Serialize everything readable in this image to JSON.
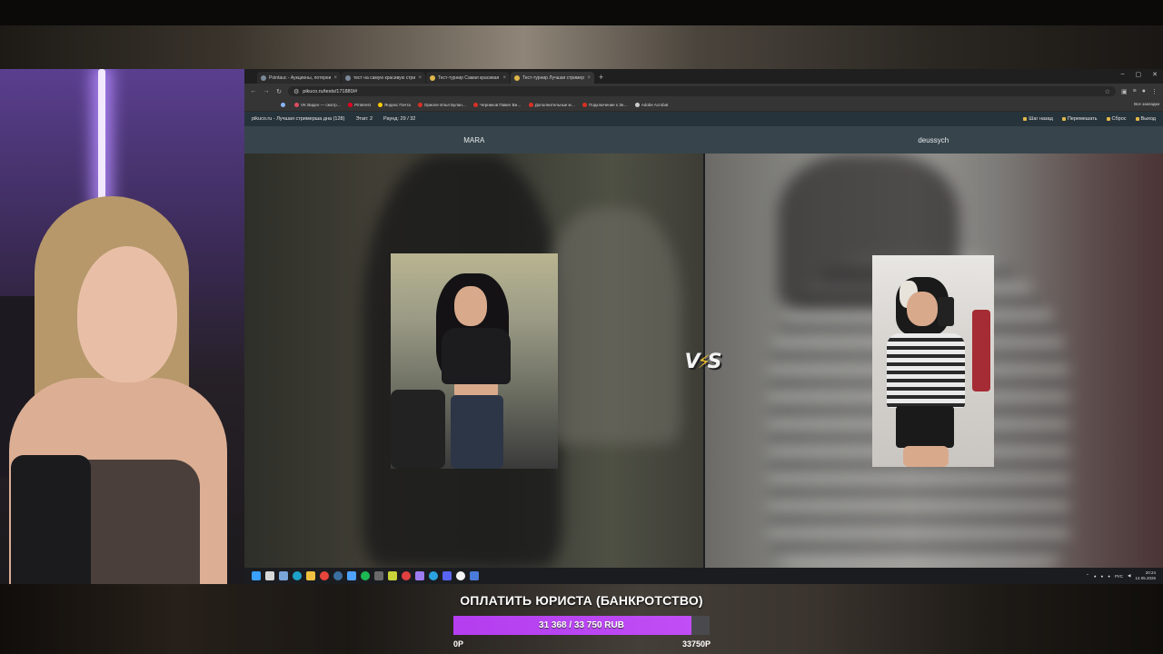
{
  "browser": {
    "tabs": [
      {
        "title": "Pointauc - Аукционы, лотереи",
        "active": false
      },
      {
        "title": "тест на самую красивую стри…",
        "active": false
      },
      {
        "title": "Тест-турнир Самая красивая…",
        "active": false
      },
      {
        "title": "Тест-турнир Лучшая стример…",
        "active": true
      }
    ],
    "url": "pikuco.ru/tests/171880/#",
    "bookmarks": [
      {
        "label": "",
        "color": "#8ab4f8"
      },
      {
        "label": "VK Видео — смотр…",
        "color": "#e04c5f"
      },
      {
        "label": "Pinterest",
        "color": "#e60023"
      },
      {
        "label": "Яндекс Почта",
        "color": "#ffcc00"
      },
      {
        "label": "Ориоле Илья Булан…",
        "color": "#d93025"
      },
      {
        "label": "Черников Павел Ви…",
        "color": "#d93025"
      },
      {
        "label": "Дополнительные м…",
        "color": "#d93025"
      },
      {
        "label": "Подключение к Эк…",
        "color": "#d93025"
      },
      {
        "label": "Adobe Acrobat",
        "color": "#cccccc"
      }
    ],
    "bookmarks_all": "Все закладки"
  },
  "page": {
    "title": "pikuco.ru - Лучшая стримерша дна (128)",
    "stage": "Этап: 2",
    "round": "Раунд: 29 / 32",
    "actions": [
      "Шаг назад",
      "Перемешать",
      "Сброс",
      "Выход"
    ],
    "left_name": "MARA",
    "right_name": "deussych",
    "vs_left": "V",
    "vs_right": "S"
  },
  "taskbar": {
    "lang": "РУС",
    "time": "20:24",
    "date": "14.05.2026"
  },
  "donation": {
    "title": "ОПЛАТИТЬ ЮРИСТА (БАНКРОТСТВО)",
    "progress_text": "31 368 / 33 750 RUB",
    "min_label": "0P",
    "max_label": "33750P",
    "fill_fraction": 0.929,
    "fill_color": "#b43ef0"
  }
}
